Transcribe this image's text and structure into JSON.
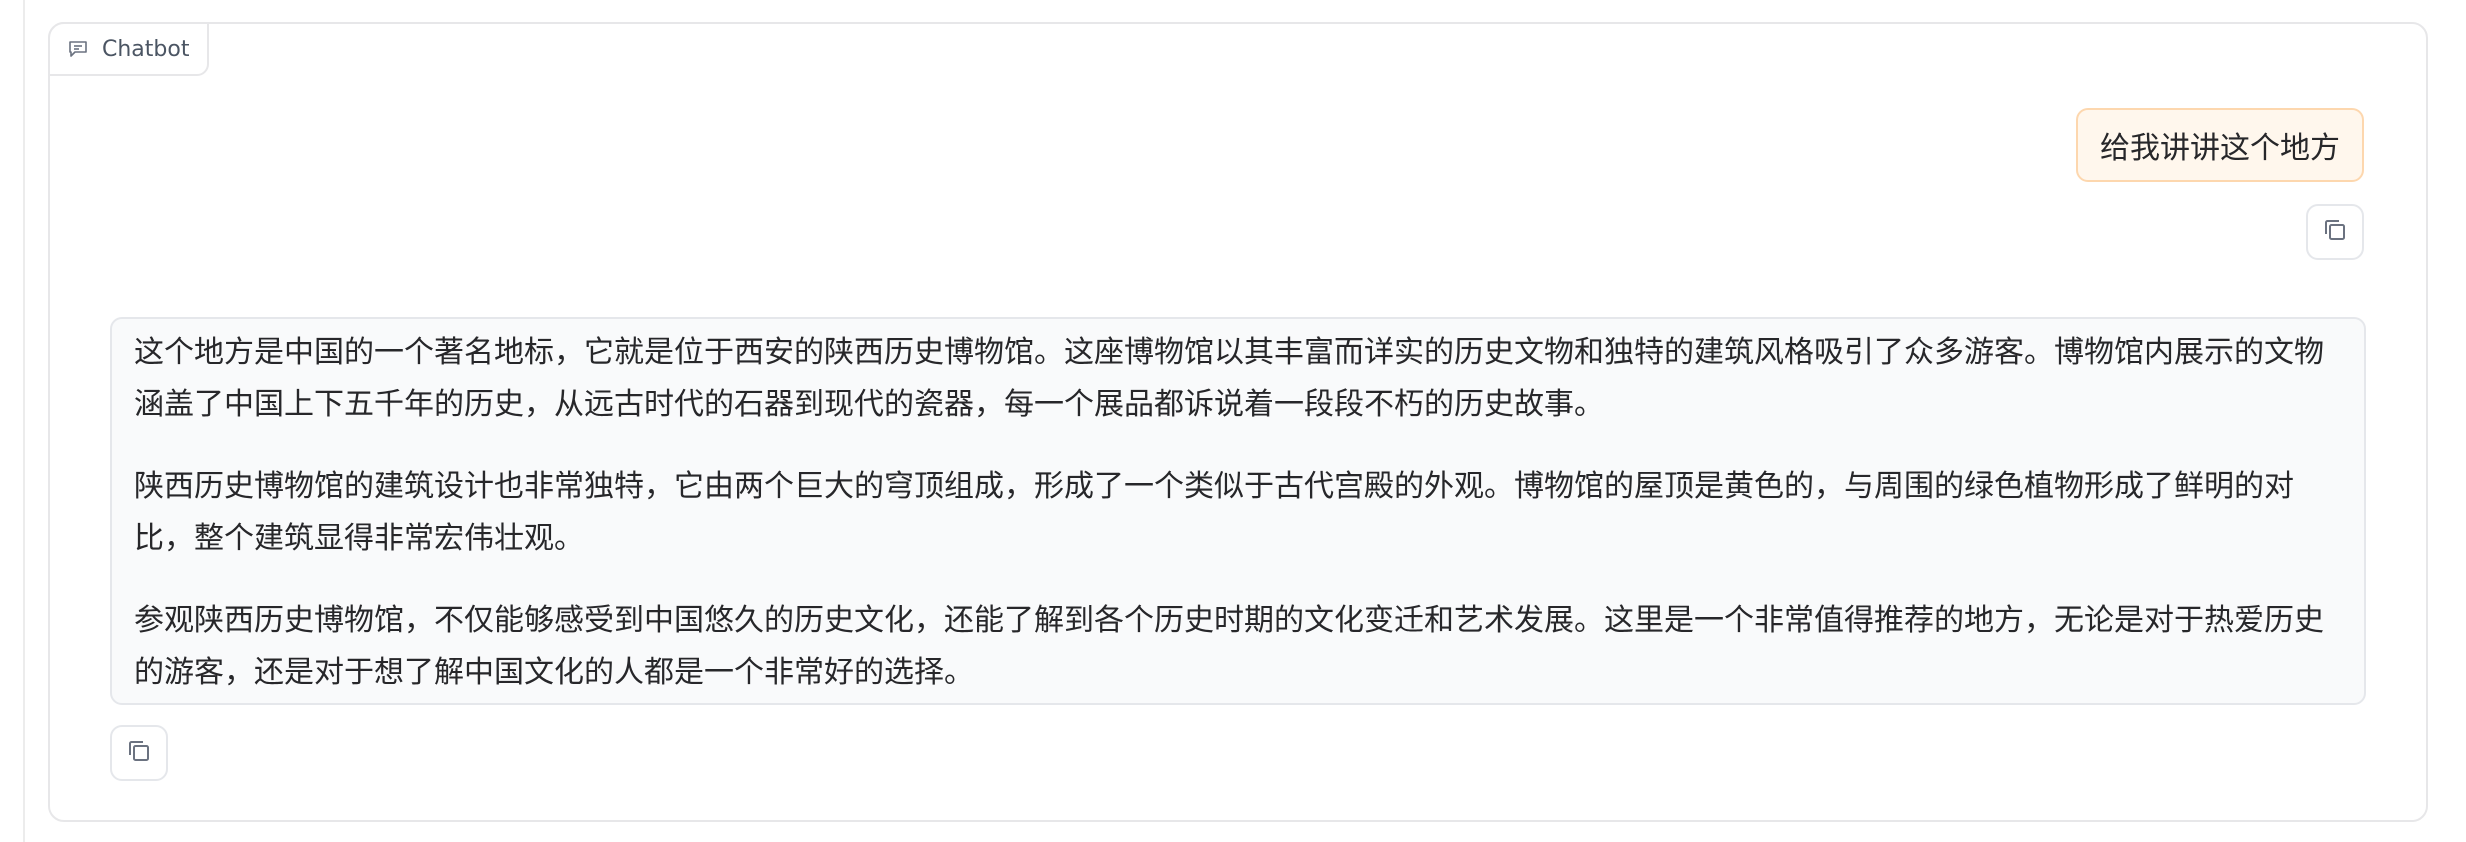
{
  "panel": {
    "label": "Chatbot",
    "label_icon": "chat-bubble-icon"
  },
  "messages": {
    "user": {
      "text": "给我讲讲这个地方",
      "copy_icon": "copy-icon"
    },
    "bot": {
      "paragraphs": [
        "这个地方是中国的一个著名地标，它就是位于西安的陕西历史博物馆。这座博物馆以其丰富而详实的历史文物和独特的建筑风格吸引了众多游客。博物馆内展示的文物涵盖了中国上下五千年的历史，从远古时代的石器到现代的瓷器，每一个展品都诉说着一段段不朽的历史故事。",
        "陕西历史博物馆的建筑设计也非常独特，它由两个巨大的穹顶组成，形成了一个类似于古代宫殿的外观。博物馆的屋顶是黄色的，与周围的绿色植物形成了鲜明的对比，整个建筑显得非常宏伟壮观。",
        "参观陕西历史博物馆，不仅能够感受到中国悠久的历史文化，还能了解到各个历史时期的文化变迁和艺术发展。这里是一个非常值得推荐的地方，无论是对于热爱历史的游客，还是对于想了解中国文化的人都是一个非常好的选择。"
      ],
      "copy_icon": "copy-icon"
    }
  },
  "colors": {
    "user_bubble_bg": "#fff7ed",
    "user_bubble_border": "#fdd7ae",
    "bot_bubble_bg": "#f9fafb",
    "border": "#e5e7eb",
    "text": "#27272a"
  }
}
